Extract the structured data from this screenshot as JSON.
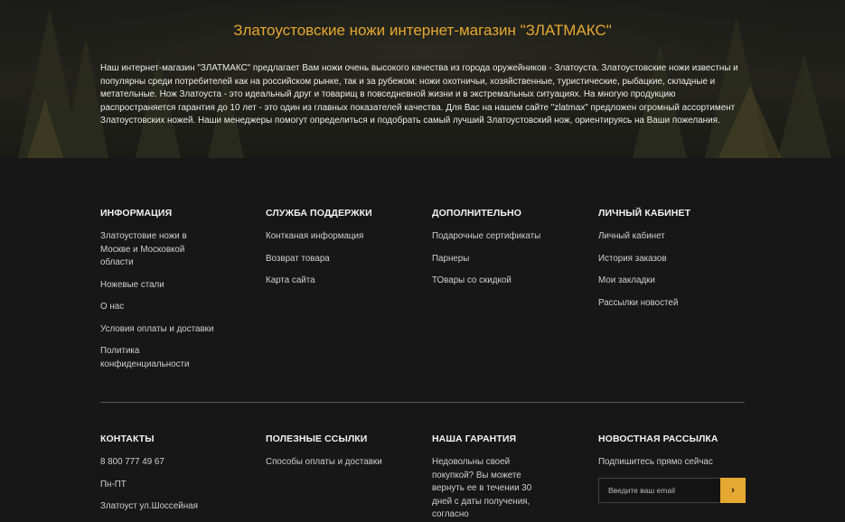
{
  "hero": {
    "title": "Златоустовские ножи интернет-магазин \"ЗЛАТМАКС\"",
    "text": "Наш интернет-магазин \"ЗЛАТМАКС\" предлагает Вам ножи очень высокого качества из города оружейников - Златоуста. Златоустовские ножи известны и популярны среди потребителей как на российском рынке, так и за рубежом: ножи охотничьи, хозяйственные, туристические, рыбацкие, складные и метательные. Нож Златоуста - это идеальный друг и товарищ в повседневной жизни и в экстремальных ситуациях. На многую продукцию распространяется гарантия до 10 лет - это один из главных показателей качества. Для Вас на нашем сайте \"zlatmax\" предложен огромный ассортимент Златоустовских ножей. Наши менеджеры помогут определиться и подобрать самый лучший Златоустовский нож, ориентируясь на Ваши пожелания."
  },
  "footer": {
    "info": {
      "heading": "ИНФОРМАЦИЯ",
      "links": [
        "Златоустовие ножи в Москве и Московкой области",
        "Ножевые стали",
        "О нас",
        "Условия оплаты и доставки",
        "Политика конфиденциальности"
      ]
    },
    "support": {
      "heading": "СЛУЖБА ПОДДЕРЖКИ",
      "links": [
        "Контканая информация",
        "Возврат товара",
        "Карта сайта"
      ]
    },
    "extra": {
      "heading": "ДОПОЛНИТЕЛЬНО",
      "links": [
        "Подарочные сертификаты",
        "Парнеры",
        "ТОвары со скидкой"
      ]
    },
    "account": {
      "heading": "ЛИЧНЫЙ КАБИНЕТ",
      "links": [
        "Личный кабинет",
        "История заказов",
        "Мои закладки",
        "Рассылки новостей"
      ]
    },
    "contacts": {
      "heading": "КОНТАКТЫ",
      "phone": "8 800 777 49 67",
      "hours": "Пн-ПТ",
      "address": "Златоуст ул.Шоссейная"
    },
    "useful": {
      "heading": "ПОЛЕЗНЫЕ ССЫЛКИ",
      "links": [
        "Способы оплаты и доставки"
      ]
    },
    "guarantee": {
      "heading": "НАША ГАРАНТИЯ",
      "text": "Недовольны своей покупкой? Вы можете вернуть ее в течении 30 дней с даты получения, согласно"
    },
    "newsletter": {
      "heading": "НОВОСТНАЯ РАССЫЛКА",
      "subtitle": "Подпишитесь прямо сейчас",
      "placeholder": "Введите ваш email",
      "button": "›"
    }
  },
  "colors": {
    "accent": "#e5a830",
    "background": "#171717"
  }
}
